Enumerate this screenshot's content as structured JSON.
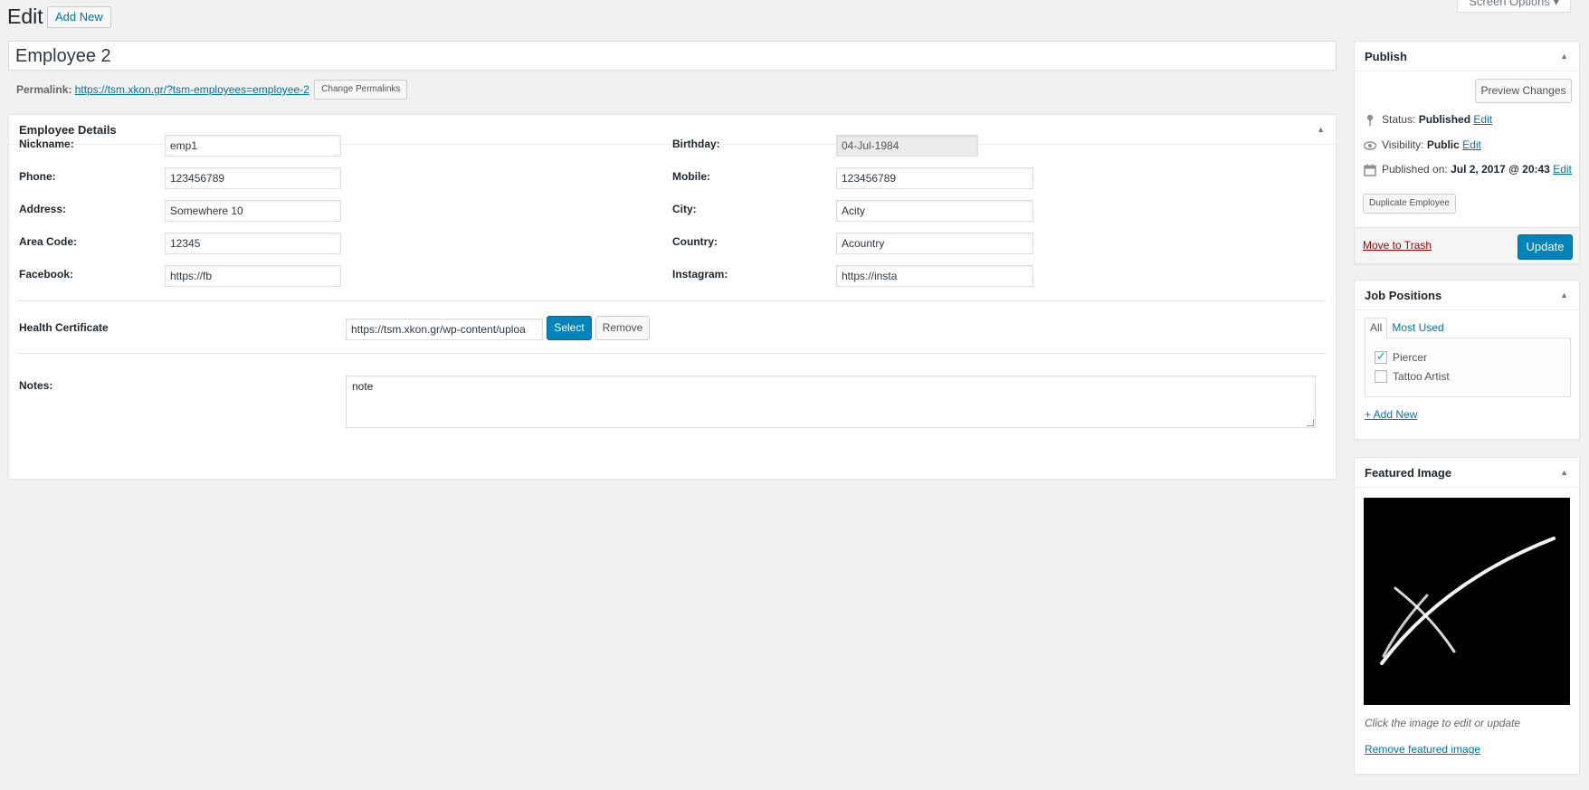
{
  "header": {
    "title": "Edit",
    "add_new": "Add New",
    "screen_options": "Screen Options ▾"
  },
  "post": {
    "title": "Employee 2",
    "permalink_label": "Permalink:",
    "permalink_url": "https://tsm.xkon.gr/?tsm-employees=employee-2",
    "change_permalinks": "Change Permalinks"
  },
  "details": {
    "heading": "Employee Details",
    "left_fields": [
      {
        "label": "Nickname:",
        "value": "emp1"
      },
      {
        "label": "Phone:",
        "value": "123456789"
      },
      {
        "label": "Address:",
        "value": "Somewhere 10"
      },
      {
        "label": "Area Code:",
        "value": "12345"
      },
      {
        "label": "Facebook:",
        "value": "https://fb"
      }
    ],
    "right_fields": [
      {
        "label": "Birthday:",
        "value": "04-Jul-1984"
      },
      {
        "label": "Mobile:",
        "value": "123456789"
      },
      {
        "label": "City:",
        "value": "Acity"
      },
      {
        "label": "Country:",
        "value": "Acountry"
      },
      {
        "label": "Instagram:",
        "value": "https://insta"
      }
    ],
    "health_label": "Health Certificate",
    "health_value": "https://tsm.xkon.gr/wp-content/uploa",
    "select_btn": "Select",
    "remove_btn": "Remove",
    "notes_label": "Notes:",
    "notes_value": "note"
  },
  "publish": {
    "heading": "Publish",
    "preview_btn": "Preview Changes",
    "status_label": "Status:",
    "status_value": "Published",
    "visibility_label": "Visibility:",
    "visibility_value": "Public",
    "published_label": "Published on:",
    "published_value": "Jul 2, 2017 @ 20:43",
    "edit_link": "Edit",
    "duplicate_btn": "Duplicate Employee",
    "trash_link": "Move to Trash",
    "update_btn": "Update"
  },
  "jobs": {
    "heading": "Job Positions",
    "tab_all": "All",
    "tab_most_used": "Most Used",
    "items": [
      {
        "label": "Piercer",
        "checked": true
      },
      {
        "label": "Tattoo Artist",
        "checked": false
      }
    ],
    "add_new": "+ Add New"
  },
  "featured": {
    "heading": "Featured Image",
    "caption": "Click the image to edit or update",
    "remove_link": "Remove featured image"
  },
  "colors": {
    "primary": "#0085ba",
    "link": "#0073aa",
    "trash": "#a00000",
    "background": "#f1f1f1"
  }
}
